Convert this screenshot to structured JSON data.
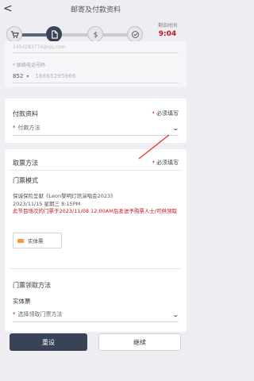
{
  "header": {
    "back": "<",
    "title": "邮寄及付款资料"
  },
  "timer": {
    "label": "剩余时间",
    "value": "9:04"
  },
  "steps": [
    {
      "name": "cart",
      "state": "done"
    },
    {
      "name": "document",
      "state": "active"
    },
    {
      "name": "payment",
      "state": "todo"
    },
    {
      "name": "confirm",
      "state": "todo"
    }
  ],
  "contact": {
    "faded_email": "1454283774@qq.com",
    "phone_label": "* 联络电话号码",
    "country_code": "852",
    "phone_number": "18665295966"
  },
  "payment": {
    "title": "付款资料",
    "required": "必须填写",
    "method_placeholder": "付款方法"
  },
  "ticket": {
    "title": "取票方法",
    "required": "必须填写",
    "mode_title": "门票模式",
    "event_name": "保诚保险呈献《Leon黎明灯馆演唱会2023》",
    "event_datetime": "2023/11/15 星期三 8:15PM",
    "warning": "此节目场次的门票于2023/11/08 12:00AM后发送予购票人士/可供领取",
    "option_label": "实体票",
    "collect_title": "门票领取方法",
    "collect_type": "实体票",
    "collect_placeholder": "选择领取门票方法"
  },
  "buttons": {
    "reset": "重设",
    "continue": "继续"
  },
  "colors": {
    "accent": "#3a4257",
    "danger": "#c4121a"
  }
}
